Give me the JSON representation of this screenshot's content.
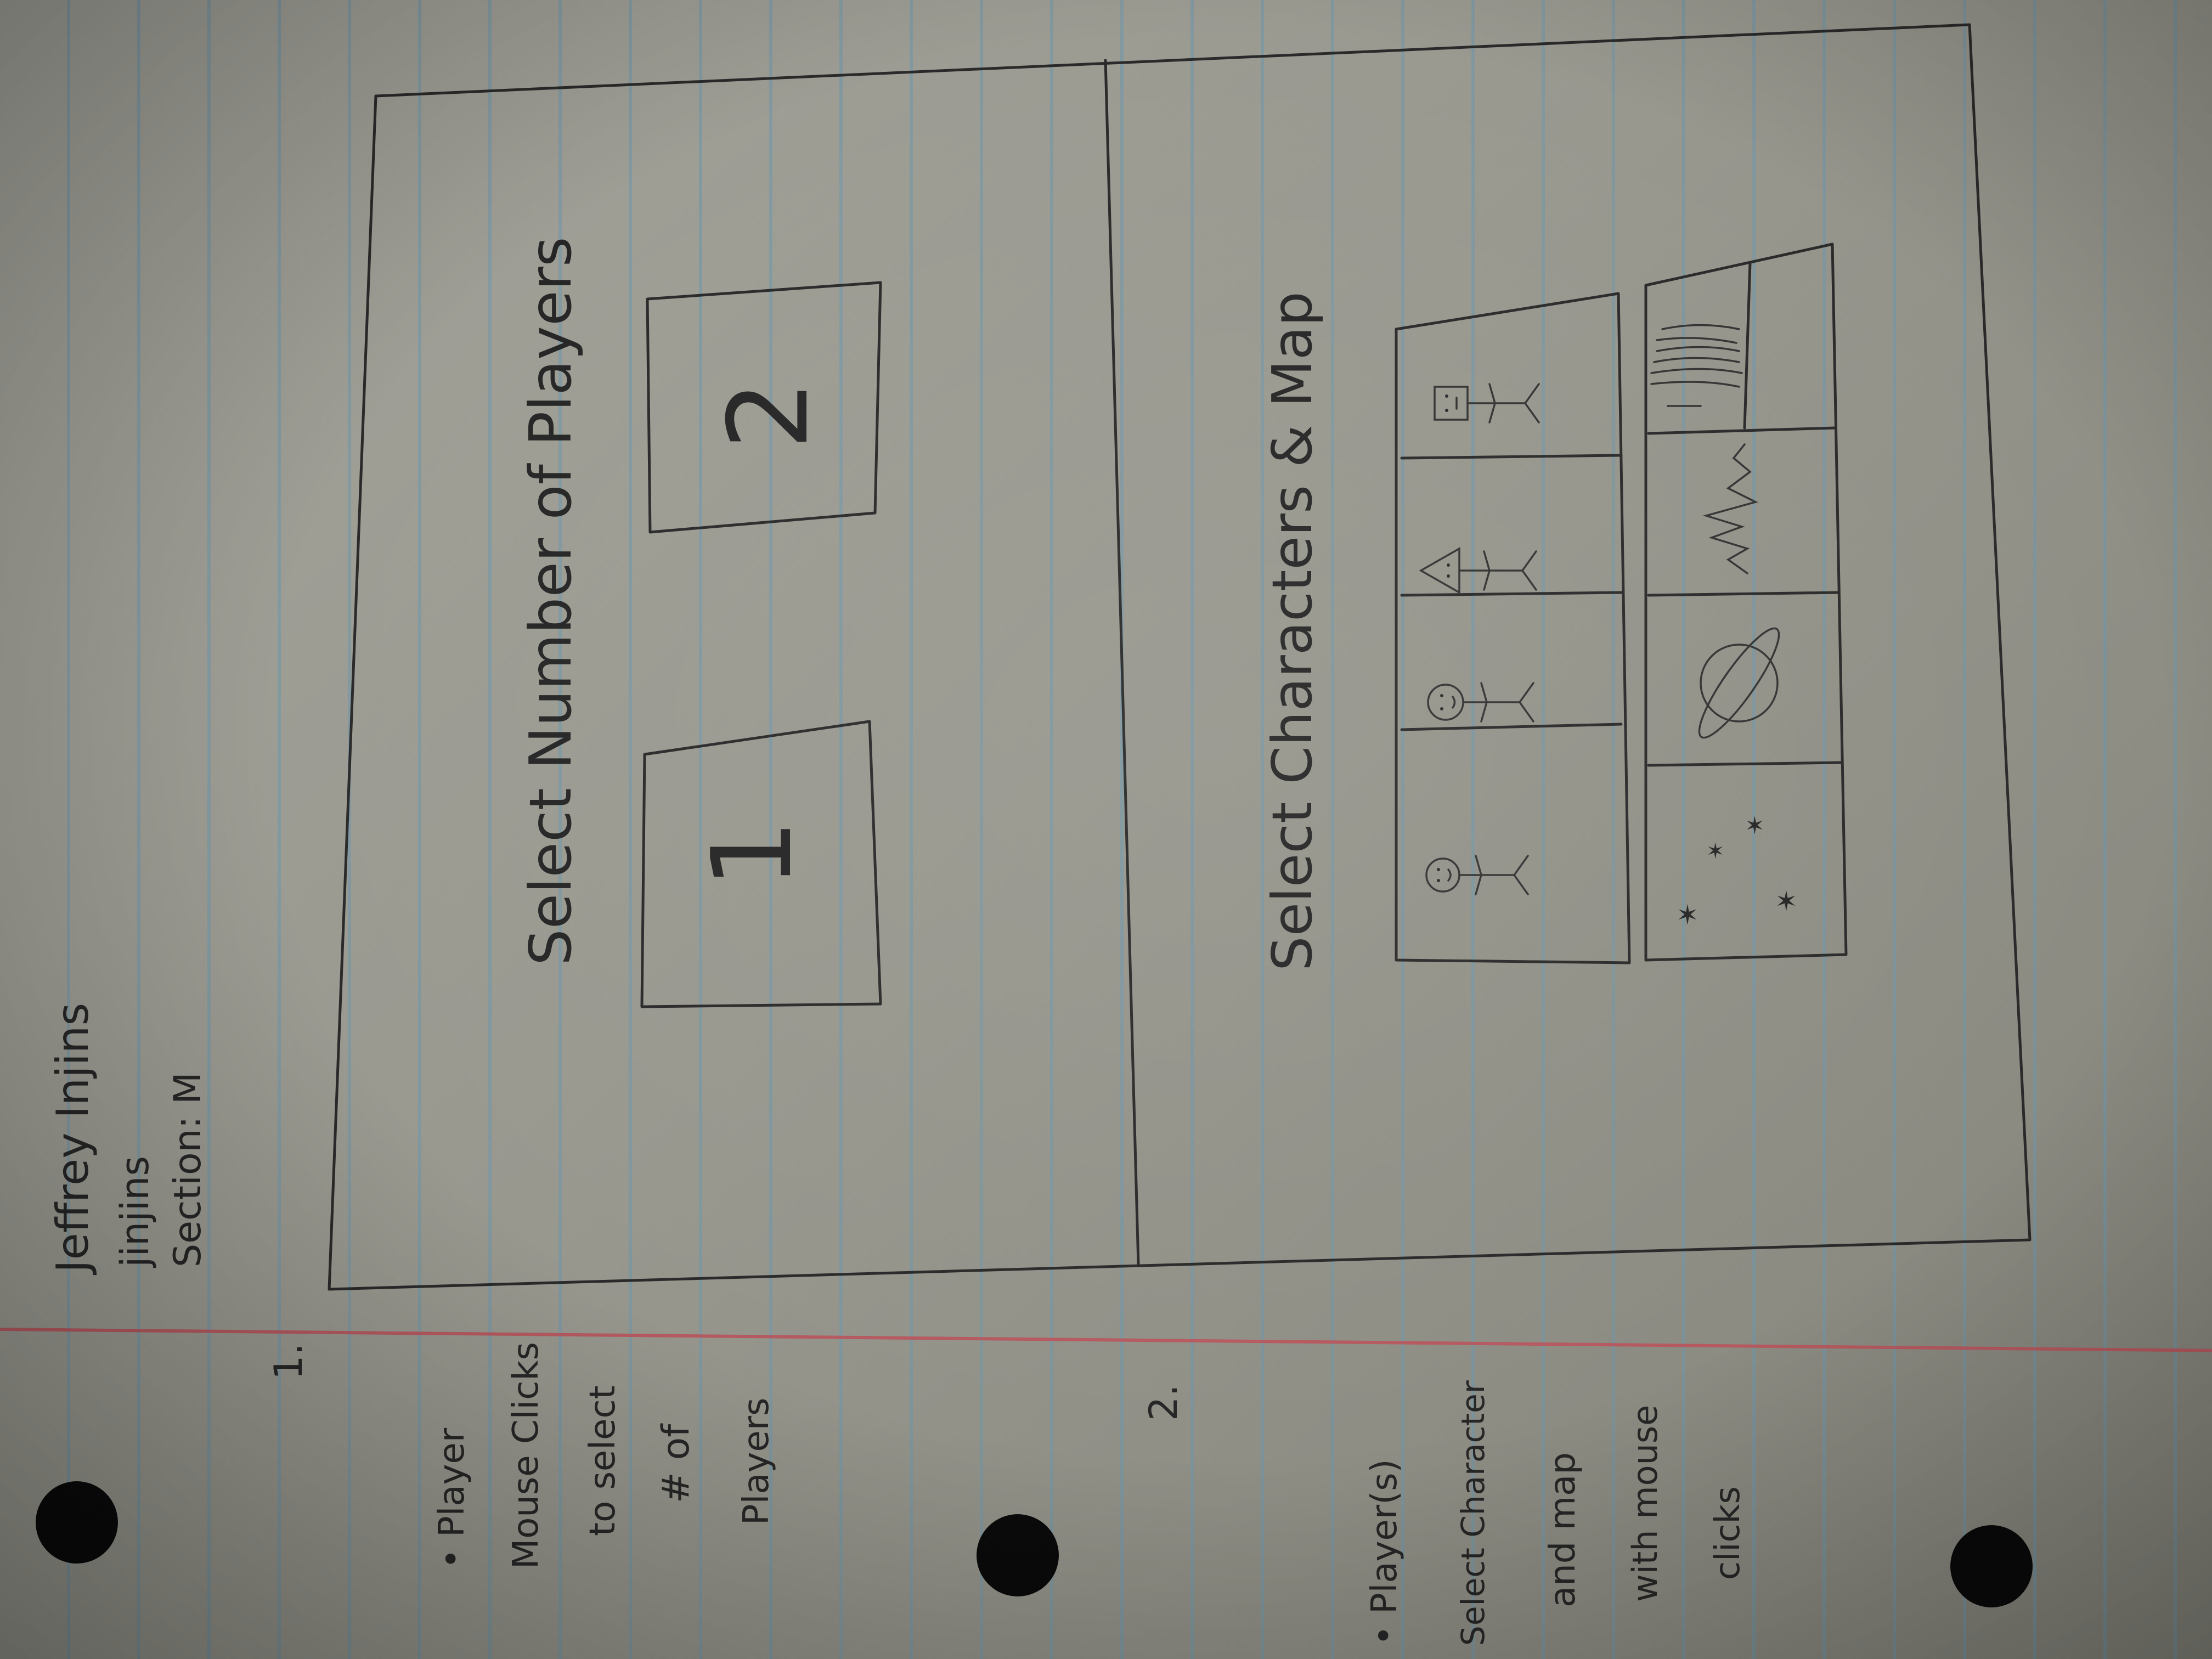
{
  "header": {
    "name": "Jeffrey Injins",
    "username": "jinjins",
    "section": "Section: M"
  },
  "screen1": {
    "number": "1.",
    "title": "Select Number of Players",
    "option_1": "1",
    "option_2": "2"
  },
  "screen2": {
    "number": "2.",
    "title": "Select Characters & Map"
  },
  "notes": {
    "note1": [
      "• Player",
      "Mouse Clicks",
      "to select",
      "# of",
      "Players"
    ],
    "note2": [
      "• Player(s)",
      "Select Character",
      "and map",
      "with mouse",
      "clicks"
    ]
  },
  "colors": {
    "ink": "#2a2a2a",
    "paper": "#9c9c94",
    "rule_line": "#6e96aa",
    "margin_line": "#b55a60"
  }
}
